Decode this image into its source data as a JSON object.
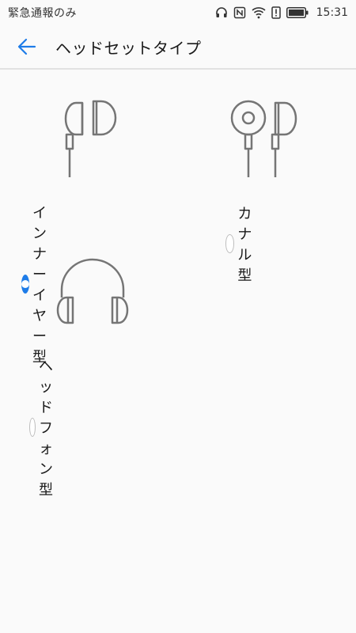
{
  "status_bar": {
    "left_text": "緊急通報のみ",
    "time": "15:31",
    "icons": [
      "headset-icon",
      "nfc-icon",
      "wifi-icon",
      "alert-icon",
      "battery-icon"
    ]
  },
  "app_bar": {
    "back_icon": "arrow-left-icon",
    "title": "ヘッドセットタイプ"
  },
  "options": [
    {
      "label": "インナーイヤー型",
      "selected": true,
      "icon": "earbud-icon"
    },
    {
      "label": "カナル型",
      "selected": false,
      "icon": "canal-earphone-icon"
    },
    {
      "label": "ヘッドフォン型",
      "selected": false,
      "icon": "headphone-icon"
    }
  ],
  "colors": {
    "accent": "#1e7ce8",
    "background": "#fafafa",
    "illustration_stroke": "#757575"
  }
}
